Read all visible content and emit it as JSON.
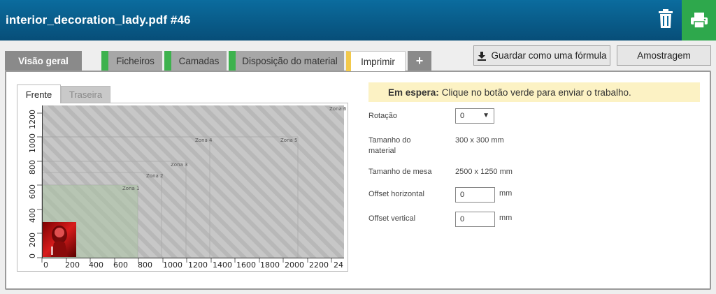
{
  "header": {
    "title": "interior_decoration_lady.pdf #46"
  },
  "tabs": [
    {
      "label": "Visão geral"
    },
    {
      "label": "Ficheiros"
    },
    {
      "label": "Camadas"
    },
    {
      "label": "Disposição do material"
    },
    {
      "label": "Imprimir"
    },
    {
      "label": "+"
    }
  ],
  "toolbar": {
    "save_formula_label": "Guardar como uma fórmula",
    "sample_label": "Amostragem"
  },
  "side_tabs": {
    "front": "Frente",
    "back": "Traseira"
  },
  "preview": {
    "x_ticks": [
      "0",
      "200",
      "400",
      "600",
      "800",
      "1000",
      "1200",
      "1400",
      "1600",
      "1800",
      "2000",
      "2200",
      "24"
    ],
    "y_ticks": [
      "0",
      "200",
      "400",
      "600",
      "800",
      "1000",
      "1200"
    ],
    "zones": [
      "Zona 1",
      "Zona 2",
      "Zona 3",
      "Zona 4",
      "Zona 5",
      "Zona 6"
    ]
  },
  "info": {
    "status": "Em espera:",
    "message": "Clique no botão verde para enviar o trabalho."
  },
  "form": {
    "rotation_label": "Rotação",
    "rotation_value": "0",
    "material_size_label": "Tamanho do material",
    "material_size_value": "300 x 300 mm",
    "table_size_label": "Tamanho de mesa",
    "table_size_value": "2500 x 1250 mm",
    "offset_h_label": "Offset horizontal",
    "offset_h_value": "0",
    "offset_v_label": "Offset vertical",
    "offset_v_value": "0",
    "unit": "mm"
  },
  "colors": {
    "accent_green": "#2ea84c",
    "header_blue": "#0b6c9e",
    "active_tab": "#f2c94c",
    "info_bg": "#fcf2c4"
  }
}
